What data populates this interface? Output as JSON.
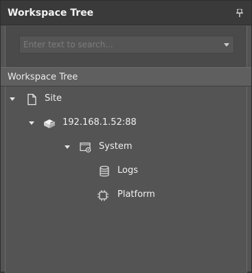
{
  "panel": {
    "title": "Workspace Tree",
    "pin_icon": "pin-icon"
  },
  "search": {
    "placeholder": "Enter text to search...",
    "dropdown_icon": "chevron-down-icon"
  },
  "tree_header": {
    "label": "Workspace Tree"
  },
  "tree": {
    "nodes": [
      {
        "label": "Site",
        "icon": "document-icon",
        "expanded": true
      },
      {
        "label": "192.168.1.52:88",
        "icon": "server-icon",
        "expanded": true
      },
      {
        "label": "System",
        "icon": "system-settings-icon",
        "expanded": true
      },
      {
        "label": "Logs",
        "icon": "database-icon"
      },
      {
        "label": "Platform",
        "icon": "chip-icon"
      }
    ]
  },
  "colors": {
    "title_bg": "#3a3a3a",
    "panel_bg": "#545454",
    "text": "#f0f0f0",
    "placeholder": "#7d7d7d"
  }
}
